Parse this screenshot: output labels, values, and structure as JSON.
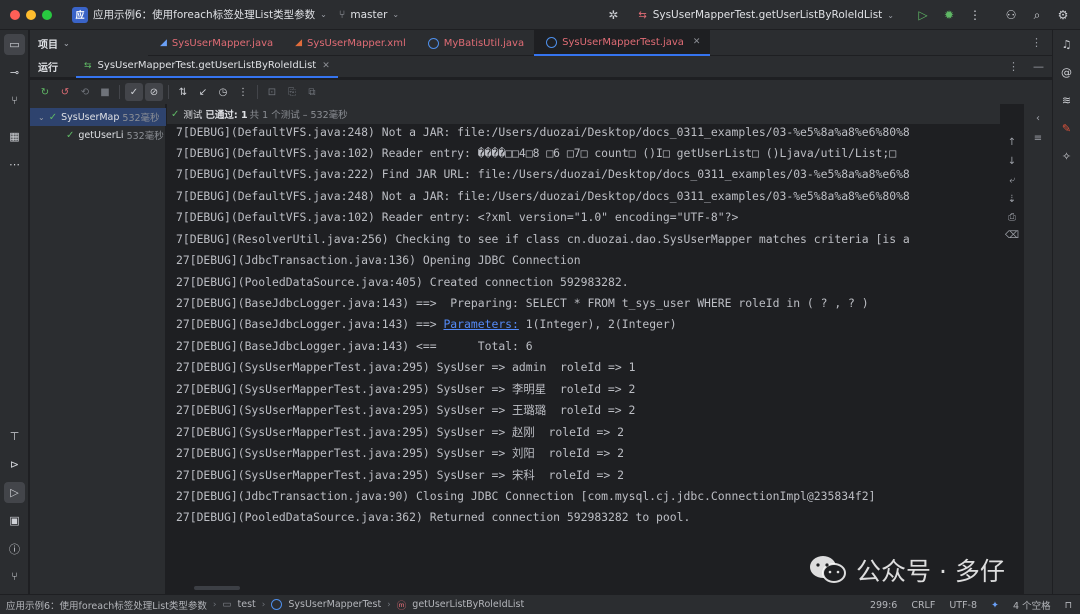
{
  "titlebar": {
    "project_badge": "应",
    "project_name": "应用示例6：使用foreach标签处理List类型参数",
    "branch": "master",
    "run_config": "SysUserMapperTest.getUserListByRoleIdList"
  },
  "sidebar": {
    "project_label": "项目"
  },
  "editor_tabs": [
    {
      "label": "SysUserMapper.java"
    },
    {
      "label": "SysUserMapper.xml"
    },
    {
      "label": "MyBatisUtil.java"
    },
    {
      "label": "SysUserMapperTest.java"
    }
  ],
  "run": {
    "title": "运行",
    "tab_label": "SysUserMapperTest.getUserListByRoleIdList"
  },
  "test_tree": {
    "root": {
      "label": "SysUserMap",
      "duration": "532毫秒"
    },
    "child": {
      "label": "getUserLi",
      "duration": "532毫秒"
    }
  },
  "test_status": {
    "prefix": "测试",
    "passed": "已通过: 1",
    "detail": "共 1 个测试 – 532毫秒"
  },
  "console_lines": [
    "7[DEBUG](DefaultVFS.java:248) Not a JAR: file:/Users/duozai/Desktop/docs_0311_examples/03-%e5%8a%a8%e6%80%8",
    "7[DEBUG](DefaultVFS.java:102) Reader entry: ����□□4□8 □6 □7□ count□ ()I□ getUserList□ ()Ljava/util/List;□",
    "7[DEBUG](DefaultVFS.java:222) Find JAR URL: file:/Users/duozai/Desktop/docs_0311_examples/03-%e5%8a%a8%e6%8",
    "7[DEBUG](DefaultVFS.java:248) Not a JAR: file:/Users/duozai/Desktop/docs_0311_examples/03-%e5%8a%a8%e6%80%8",
    "7[DEBUG](DefaultVFS.java:102) Reader entry: <?xml version=\"1.0\" encoding=\"UTF-8\"?>",
    "7[DEBUG](ResolverUtil.java:256) Checking to see if class cn.duozai.dao.SysUserMapper matches criteria [is a",
    "27[DEBUG](JdbcTransaction.java:136) Opening JDBC Connection",
    "27[DEBUG](PooledDataSource.java:405) Created connection 592983282.",
    "27[DEBUG](BaseJdbcLogger.java:143) ==>  Preparing: SELECT * FROM t_sys_user WHERE roleId in ( ? , ? )",
    "27[DEBUG](BaseJdbcLogger.java:143) <==      Total: 6",
    "27[DEBUG](SysUserMapperTest.java:295) SysUser => admin  roleId => 1",
    "27[DEBUG](SysUserMapperTest.java:295) SysUser => 李明星  roleId => 2",
    "27[DEBUG](SysUserMapperTest.java:295) SysUser => 王璐璐  roleId => 2",
    "27[DEBUG](SysUserMapperTest.java:295) SysUser => 赵刚  roleId => 2",
    "27[DEBUG](SysUserMapperTest.java:295) SysUser => 刘阳  roleId => 2",
    "27[DEBUG](SysUserMapperTest.java:295) SysUser => 宋科  roleId => 2",
    "27[DEBUG](JdbcTransaction.java:90) Closing JDBC Connection [com.mysql.cj.jdbc.ConnectionImpl@235834f2]",
    "27[DEBUG](PooledDataSource.java:362) Returned connection 592983282 to pool."
  ],
  "params_line": {
    "prefix": "27[DEBUG](BaseJdbcLogger.java:143) ==> ",
    "link": "Parameters:",
    "suffix": " 1(Integer), 2(Integer)"
  },
  "statusbar": {
    "crumbs": [
      "应用示例6：使用foreach标签处理List类型参数",
      "test",
      "SysUserMapperTest",
      "getUserListByRoleIdList"
    ],
    "position": "299:6",
    "line_sep": "CRLF",
    "encoding": "UTF-8",
    "indent": "4 个空格"
  },
  "watermark": {
    "text": "公众号 · 多仔"
  },
  "colors": {
    "accent": "#3574f0",
    "pass_green": "#5fb865",
    "link_blue": "#548af7"
  }
}
